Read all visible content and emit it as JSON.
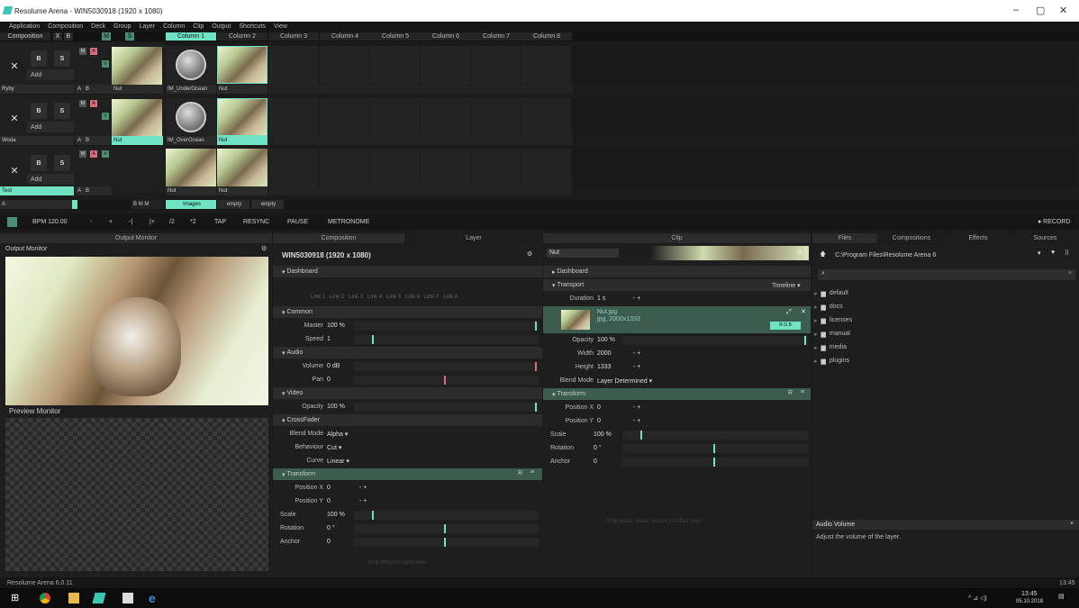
{
  "window": {
    "title": "Resolume Arena - WIN5030918 (1920 x 1080)",
    "minimize": "–",
    "maximize": "▢",
    "close": "✕"
  },
  "menu": [
    "Application",
    "Composition",
    "Deck",
    "Group",
    "Layer",
    "Column",
    "Clip",
    "Output",
    "Shortcuts",
    "View"
  ],
  "comp_header": {
    "label": "Composition",
    "x": "X",
    "b": "B",
    "m": "M",
    "s": "S"
  },
  "columns": [
    "Column 1",
    "Column 2",
    "Column 3",
    "Column 4",
    "Column 5",
    "Column 6",
    "Column 7",
    "Column 8"
  ],
  "layers": [
    {
      "name": "Ryby",
      "b": "B",
      "s": "S",
      "add": "Add",
      "ab_a": "A",
      "ab_b": "B",
      "clips": [
        "Nut",
        "IM_UnderOcean",
        "Nut"
      ]
    },
    {
      "name": "Woda",
      "b": "B",
      "s": "S",
      "add": "Add",
      "ab_a": "A",
      "ab_b": "B",
      "clips": [
        "Nut",
        "IM_OverOcean",
        "Nut"
      ]
    },
    {
      "name": "Test",
      "b": "B",
      "s": "S",
      "add": "Add",
      "ab_a": "A",
      "ab_b": "B",
      "clips": [
        "",
        "Nut",
        "Nut"
      ]
    }
  ],
  "deck_row": {
    "a": "A",
    "b": "B",
    "m": "M",
    "n": "M",
    "decks": [
      "Images",
      "empty",
      "empty"
    ]
  },
  "transport": {
    "bpm": "BPM 120.00",
    "minus": "-",
    "plus": "+",
    "prev": "-|",
    "next": "|+",
    "div": "/2",
    "mul": "*2",
    "tap": "TAP",
    "resync": "RESYNC",
    "pause": "PAUSE",
    "metronome": "METRONOME",
    "record": "● RECORD"
  },
  "panel_headers": {
    "output": "Output Monitor",
    "composition": "Composition",
    "layer": "Layer",
    "clip": "Clip",
    "files": "Files",
    "compositions": "Compositions",
    "effects": "Effects",
    "sources": "Sources"
  },
  "output_panel": {
    "output_label": "Output Monitor",
    "preview_label": "Preview Monitor"
  },
  "layer_panel": {
    "title": "WIN5030918 (1920 x 1080)",
    "dashboard": "Dashboard",
    "links": [
      "Link 1",
      "Link 2",
      "Link 3",
      "Link 4",
      "Link 5",
      "Link 6",
      "Link 7",
      "Link 8"
    ],
    "common": "Common",
    "master_k": "Master",
    "master_v": "100 %",
    "speed_k": "Speed",
    "speed_v": "1",
    "audio": "Audio",
    "volume_k": "Volume",
    "volume_v": "0 dB",
    "pan_k": "Pan",
    "pan_v": "0",
    "video": "Video",
    "opacity_k": "Opacity",
    "opacity_v": "100 %",
    "crossfader": "CrossFader",
    "blend_k": "Blend Mode",
    "blend_v": "Alpha ▾",
    "behaviour_k": "Behaviour",
    "behaviour_v": "Cut ▾",
    "curve_k": "Curve",
    "curve_v": "Linear ▾",
    "transform": "Transform",
    "px_k": "Position X",
    "px_v": "0",
    "py_k": "Position Y",
    "py_v": "0",
    "scale_k": "Scale",
    "scale_v": "100 %",
    "rot_k": "Rotation",
    "rot_v": "0 °",
    "anchor_k": "Anchor",
    "anchor_v": "0",
    "drop": "Drop effect or mask here",
    "pm": "- +",
    "r": "R"
  },
  "clip_panel": {
    "name": "Nut",
    "dashboard": "Dashboard",
    "transport": "Transport",
    "timeline": "Timeline ▾",
    "duration_k": "Duration",
    "duration_v": "1 s",
    "pm": "- +",
    "file": "Nut.jpg",
    "file_info": "jpg, 2000x1333",
    "rgb": "R G B",
    "opacity_k": "Opacity",
    "opacity_v": "100 %",
    "width_k": "Width",
    "width_v": "2000",
    "height_k": "Height",
    "height_v": "1333",
    "blend_k": "Blend Mode",
    "blend_v": "Layer Determined ▾",
    "transform": "Transform",
    "px_k": "Position X",
    "px_v": "0",
    "py_k": "Position Y",
    "py_v": "0",
    "scale_k": "Scale",
    "scale_v": "100 %",
    "rot_k": "Rotation",
    "rot_v": "0 °",
    "anchor_k": "Anchor",
    "anchor_v": "0",
    "drop": "Drop audio, mask, source or effect here",
    "r": "R"
  },
  "files_panel": {
    "path": "C:\\Program Files\\Resolume Arena 6",
    "folders": [
      "default",
      "docs",
      "licenses",
      "manual",
      "media",
      "plugins"
    ],
    "audio_title": "Audio Volume",
    "audio_desc": "Adjust the volume of the layer."
  },
  "status": {
    "version": "Resolume Arena 6.0.11",
    "time": "13:45"
  },
  "taskbar": {
    "time": "13:45",
    "date": "05.10.2018"
  },
  "colors": {
    "accent": "#6fe3c3",
    "section_green": "#3c5c4e",
    "mark_green": "#6fe3c3",
    "mark_red": "#d96a7a"
  }
}
